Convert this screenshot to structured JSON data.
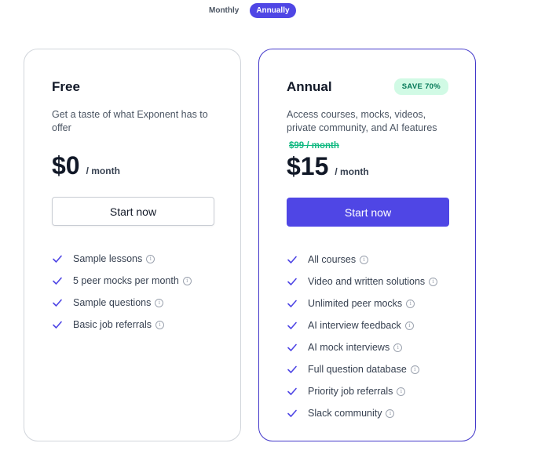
{
  "billing_toggle": {
    "options": [
      "Monthly",
      "Annually"
    ],
    "selected": "Annually"
  },
  "plans": [
    {
      "name": "Free",
      "description": "Get a taste of what Exponent has to offer",
      "price": "$0",
      "period": "/ month",
      "button": "Start now",
      "features": [
        "Sample lessons",
        "5 peer mocks per month",
        "Sample questions",
        "Basic job referrals"
      ]
    },
    {
      "name": "Annual",
      "badge": "SAVE 70%",
      "description": "Access courses, mocks, videos, private community, and AI features",
      "original_price": "$99 / month",
      "price": "$15",
      "period": "/ month",
      "button": "Start now",
      "features": [
        "All courses",
        "Video and written solutions",
        "Unlimited peer mocks",
        "AI interview feedback",
        "AI mock interviews",
        "Full question database",
        "Priority job referrals",
        "Slack community"
      ]
    }
  ],
  "icons": {
    "check": "check-icon",
    "info": "info-icon"
  },
  "colors": {
    "accent": "#4f46e5",
    "accent_border": "#4338ca",
    "badge_bg": "#d1fae5",
    "badge_text": "#047857",
    "strike": "#10b981"
  }
}
